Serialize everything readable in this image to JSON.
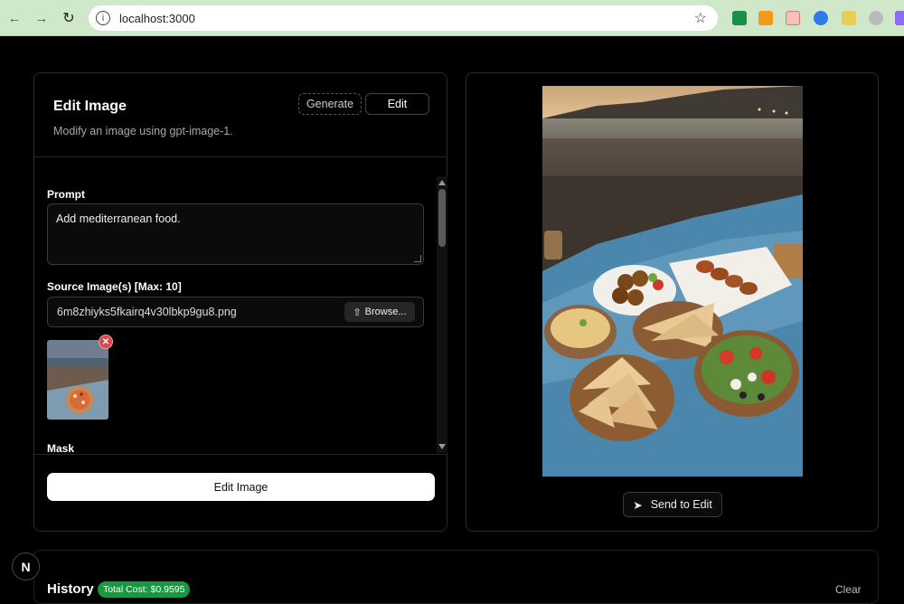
{
  "browser": {
    "back_icon": "←",
    "forward_icon": "→",
    "reload_icon": "↻",
    "info_icon": "i",
    "url": "localhost:3000",
    "star_icon": "☆"
  },
  "edit_panel": {
    "title": "Edit Image",
    "subtitle": "Modify an image using gpt-image-1.",
    "mode_generate": "Generate",
    "mode_edit": "Edit",
    "prompt_label": "Prompt",
    "prompt_value": "Add mediterranean food.",
    "source_label": "Source Image(s) [Max: 10]",
    "file_name": "6m8zhiyks5fkairq4v30lbkp9gu8.png",
    "browse_label": "Browse...",
    "upload_icon": "⇧",
    "remove_icon": "✕",
    "mask_label": "Mask",
    "submit_label": "Edit Image"
  },
  "result_panel": {
    "send_label": "Send to Edit",
    "send_icon": "➤"
  },
  "history": {
    "title": "History",
    "cost_badge": "Total Cost: $0.9595",
    "clear_label": "Clear"
  },
  "nextjs_badge": "N",
  "colors": {
    "chrome": "#cfe8c9",
    "background": "#000000",
    "cost_badge": "#169941",
    "remove_button": "#d9464c"
  }
}
